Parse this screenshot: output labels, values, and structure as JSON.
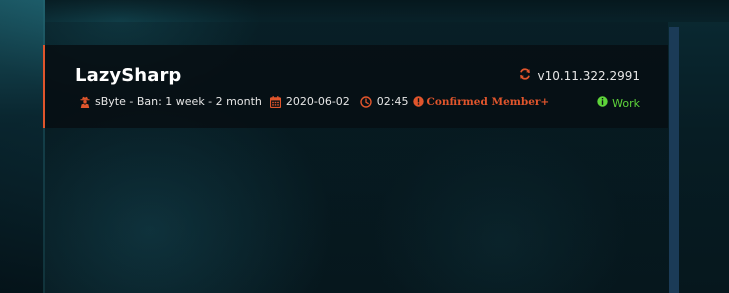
{
  "card": {
    "title": "LazySharp",
    "version": "v10.11.322.2991",
    "author": "sByte - Ban: 1 week - 2 month",
    "date": "2020-06-02",
    "time": "02:45",
    "role": "Confirmed Member+",
    "status": "Work"
  },
  "colors": {
    "accent": "#e0552c",
    "status": "#5ed43a",
    "card_bg": "#070f13",
    "scrollbar": "#1b3b57"
  },
  "icons": {
    "version": "refresh-icon",
    "author": "user-secret-icon",
    "date": "calendar-icon",
    "time": "clock-icon",
    "role": "exclamation-circle-icon",
    "status": "info-circle-icon"
  }
}
